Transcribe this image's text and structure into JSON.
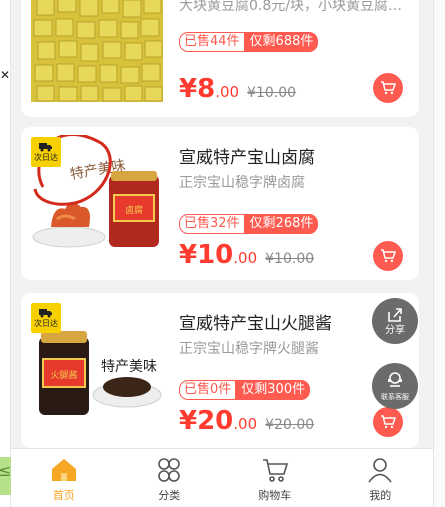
{
  "products": [
    {
      "title": "",
      "subtitle": "大块黄豆腐0.8元/块，小块黄豆腐…",
      "sold": "已售44件",
      "remaining": "仅剩688件",
      "price_yuan": "¥8",
      "price_cents": ".00",
      "original_price": "¥10.00",
      "delivery_badge": ""
    },
    {
      "title": "宣威特产宝山卤腐",
      "subtitle": "正宗宝山稳字牌卤腐",
      "sold": "已售32件",
      "remaining": "仅剩268件",
      "price_yuan": "¥10",
      "price_cents": ".00",
      "original_price": "¥10.00",
      "delivery_badge": "次日达",
      "image_caption": "特产美味"
    },
    {
      "title": "宣威特产宝山火腿酱",
      "subtitle": "正宗宝山稳字牌火腿酱",
      "sold": "已售0件",
      "remaining": "仅剩300件",
      "price_yuan": "¥20",
      "price_cents": ".00",
      "original_price": "¥20.00",
      "delivery_badge": "次日达",
      "image_caption": "特产美味"
    }
  ],
  "floating": {
    "share_label": "分享",
    "service_label": "联系客服"
  },
  "tabbar": {
    "items": [
      {
        "label": "首页",
        "icon": "home-icon",
        "active": true
      },
      {
        "label": "分类",
        "icon": "category-icon",
        "active": false
      },
      {
        "label": "购物车",
        "icon": "cart-icon",
        "active": false
      },
      {
        "label": "我的",
        "icon": "user-icon",
        "active": false
      }
    ]
  },
  "colors": {
    "accent_red": "#ff3b30",
    "badge_red": "#ff5a4f",
    "tab_active": "#f5a623",
    "delivery_yellow": "#f7d000"
  }
}
